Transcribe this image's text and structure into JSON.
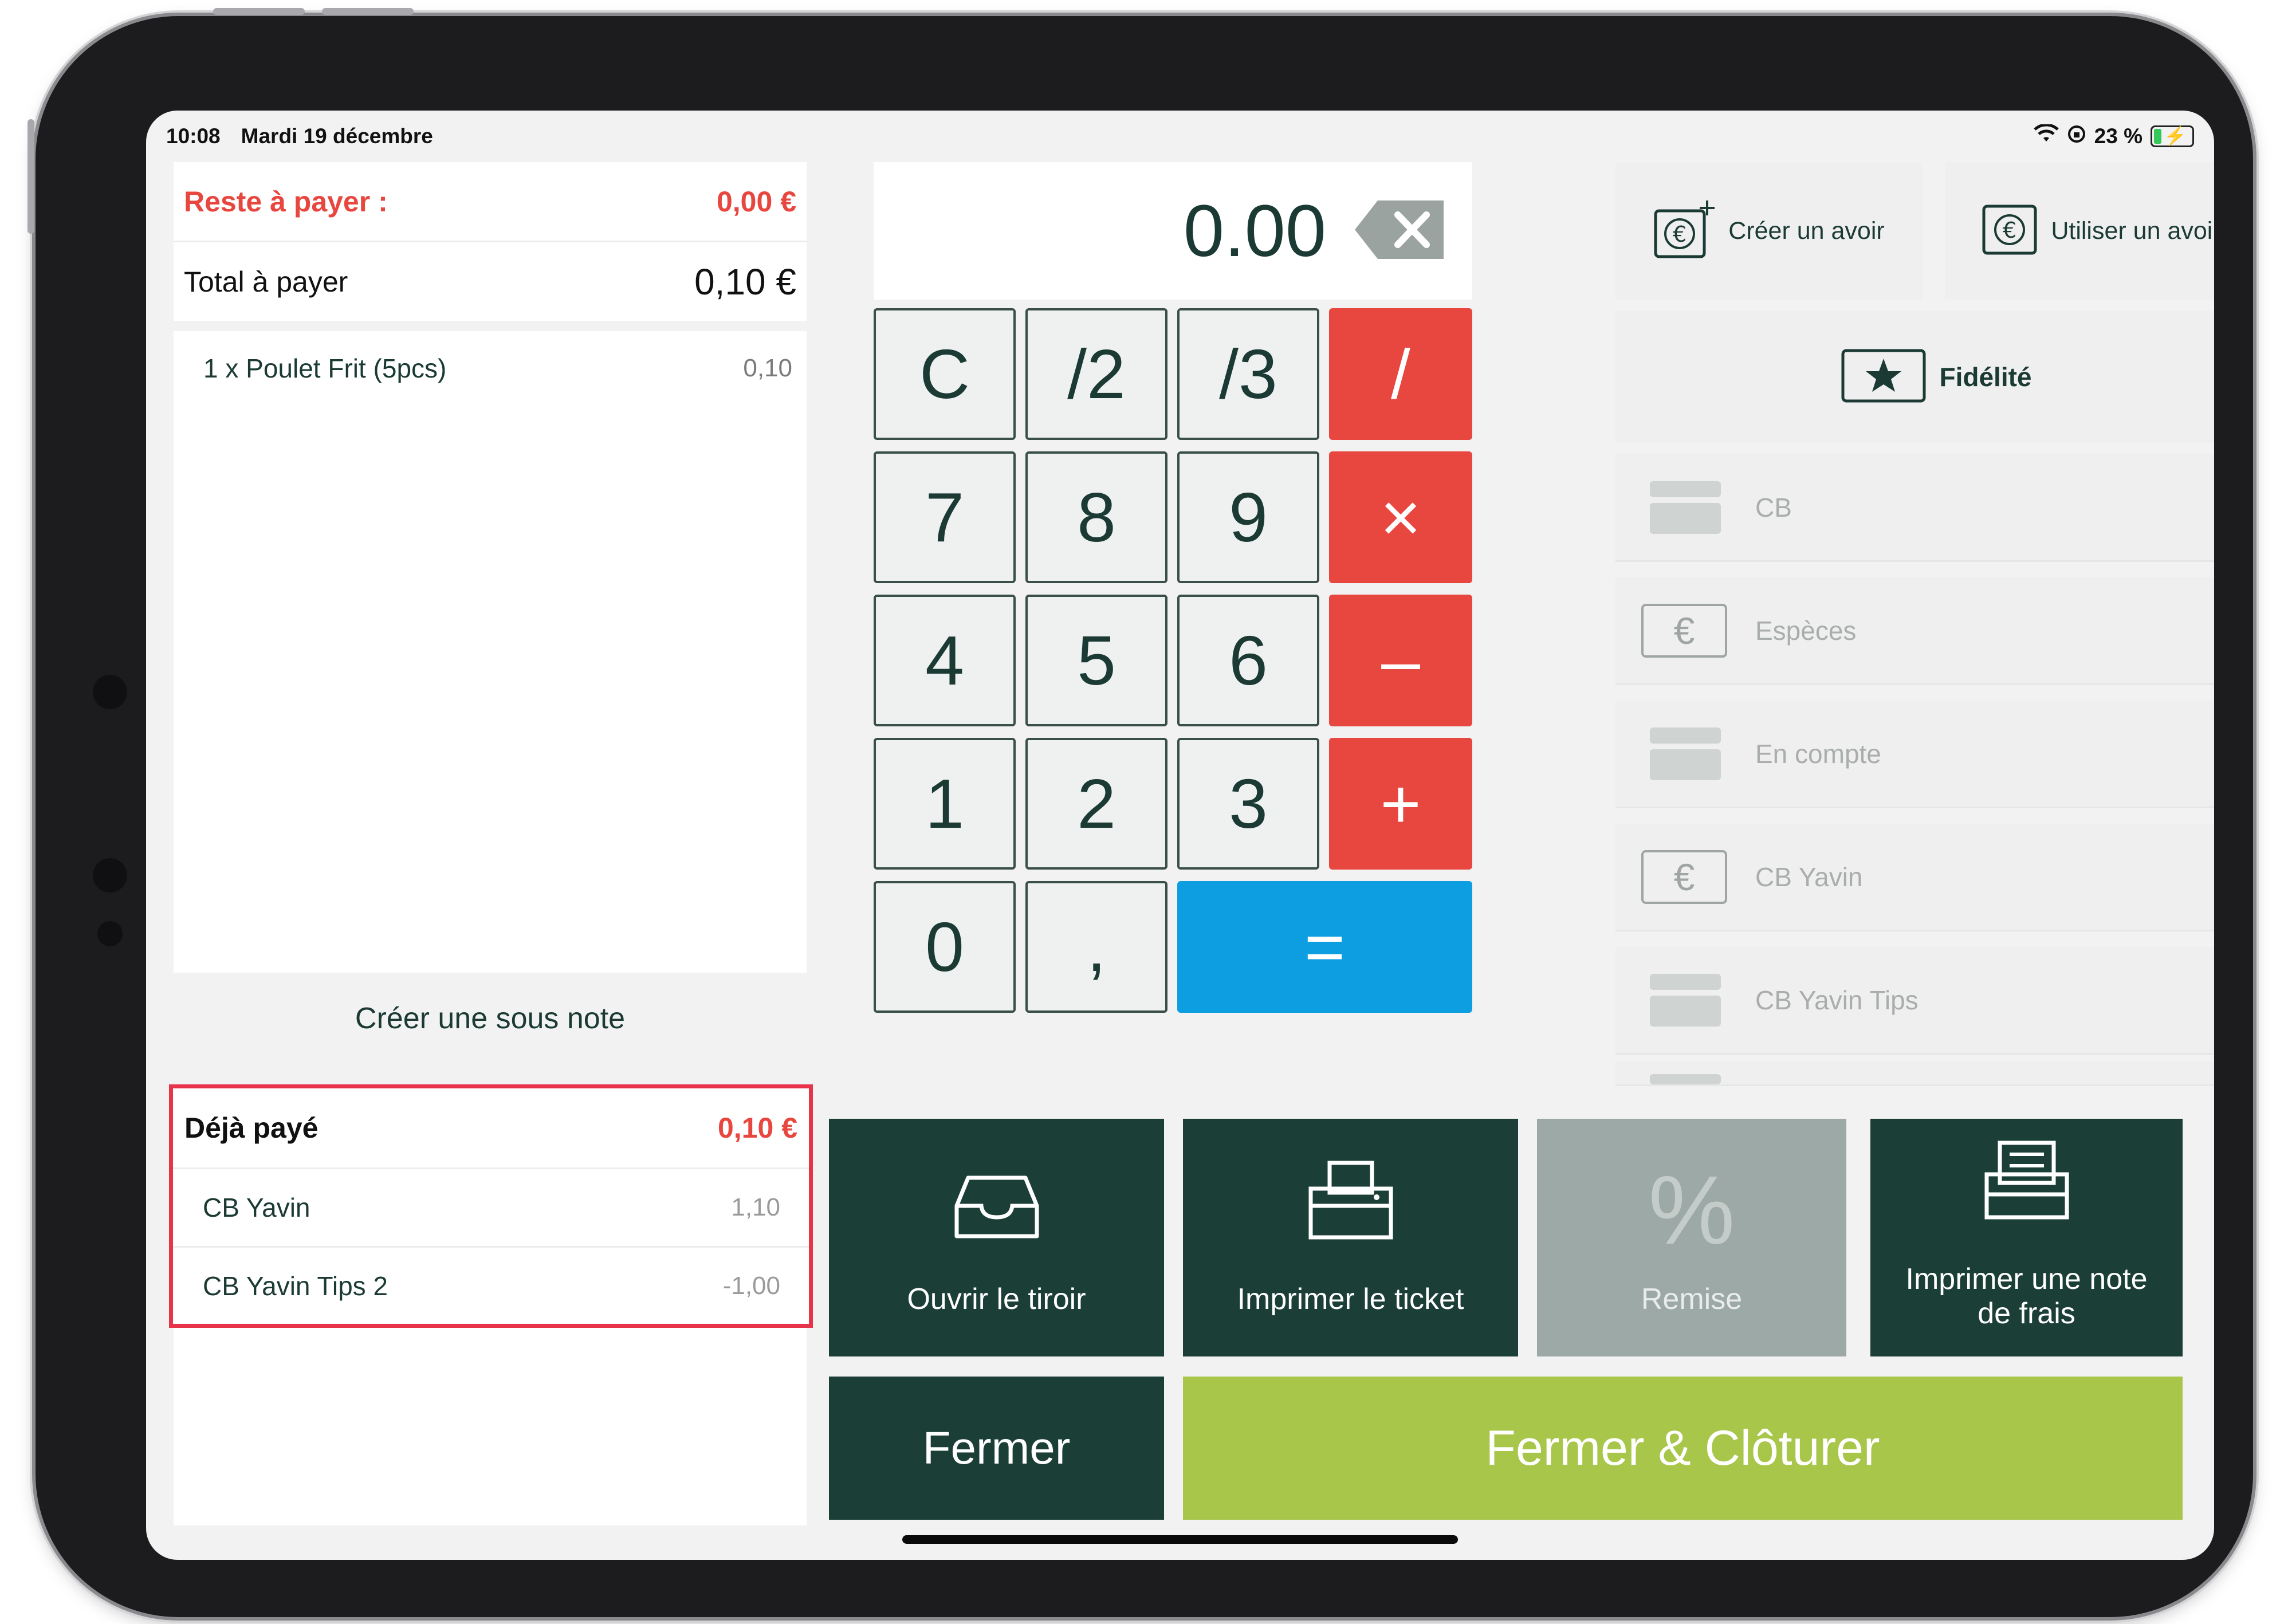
{
  "status_bar": {
    "time": "10:08",
    "date": "Mardi 19 décembre",
    "battery": "23 %",
    "battery_level": 0.23
  },
  "summary": {
    "remaining_label": "Reste à payer :",
    "remaining_value": "0,00 €",
    "total_label": "Total à payer",
    "total_value": "0,10 €"
  },
  "order_lines": [
    {
      "label": "1 x Poulet Frit (5pcs)",
      "amount": "0,10"
    }
  ],
  "sub_note_button": "Créer une sous note",
  "already_paid": {
    "label": "Déjà payé",
    "value": "0,10 €",
    "items": [
      {
        "label": "CB Yavin",
        "amount": "1,10"
      },
      {
        "label": "CB Yavin Tips 2",
        "amount": "-1,00"
      }
    ]
  },
  "keypad": {
    "display": "0.00",
    "keys": {
      "c": "C",
      "half": "/2",
      "third": "/3",
      "divide": "/",
      "seven": "7",
      "eight": "8",
      "nine": "9",
      "multiply": "×",
      "four": "4",
      "five": "5",
      "six": "6",
      "minus": "–",
      "one": "1",
      "two": "2",
      "three": "3",
      "plus": "+",
      "zero": "0",
      "comma": ",",
      "equals": "="
    }
  },
  "credit": {
    "create": "Créer un avoir",
    "use": "Utiliser un avoir",
    "loyalty": "Fidélité"
  },
  "payment_methods": [
    {
      "label": "CB",
      "icon": "card-icon"
    },
    {
      "label": "Espèces",
      "icon": "euro-note-icon"
    },
    {
      "label": "En compte",
      "icon": "card-icon"
    },
    {
      "label": "CB Yavin",
      "icon": "euro-note-icon"
    },
    {
      "label": "CB Yavin Tips",
      "icon": "card-icon"
    }
  ],
  "actions": {
    "drawer": "Ouvrir le tiroir",
    "print_ticket": "Imprimer le ticket",
    "discount": "Remise",
    "discount_symbol": "%",
    "expense_note_line1": "Imprimer une note",
    "expense_note_line2": "de frais",
    "close": "Fermer",
    "close_and_finalize": "Fermer & Clôturer"
  },
  "colors": {
    "accent_red": "#e8473f",
    "dark_green": "#1b3f36",
    "lime": "#a8c64a",
    "blue": "#0c9ee0",
    "disabled_grey": "#9da9a6",
    "highlight_border": "#e8344a"
  }
}
